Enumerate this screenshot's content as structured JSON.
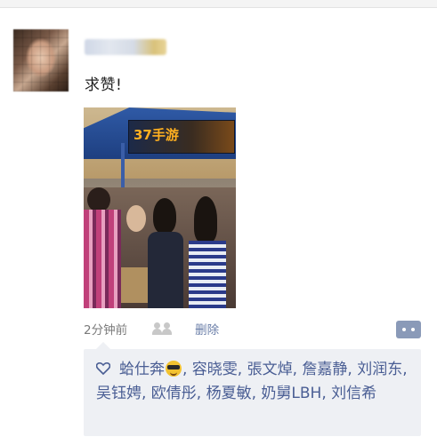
{
  "post": {
    "author_name": "",
    "text": "求赞!",
    "time": "2分钟前",
    "delete_label": "删除"
  },
  "likes": {
    "first_name": "蛤仕奔",
    "rest": ", 容晓雯, 張文焯, 詹嘉静, 刘润东, 吴钰娉, 欧倩彤, 杨夏敏, 奶舅LBH, 刘信希"
  },
  "photo": {
    "banner_text": "37手游"
  },
  "colors": {
    "name_link": "#4a5e94",
    "likes_bg": "#eef0f4",
    "comment_button": "#8a9ab8"
  },
  "icons": [
    "heart-icon",
    "sunglasses-emoji-icon",
    "group-visibility-icon",
    "comment-more-icon"
  ]
}
